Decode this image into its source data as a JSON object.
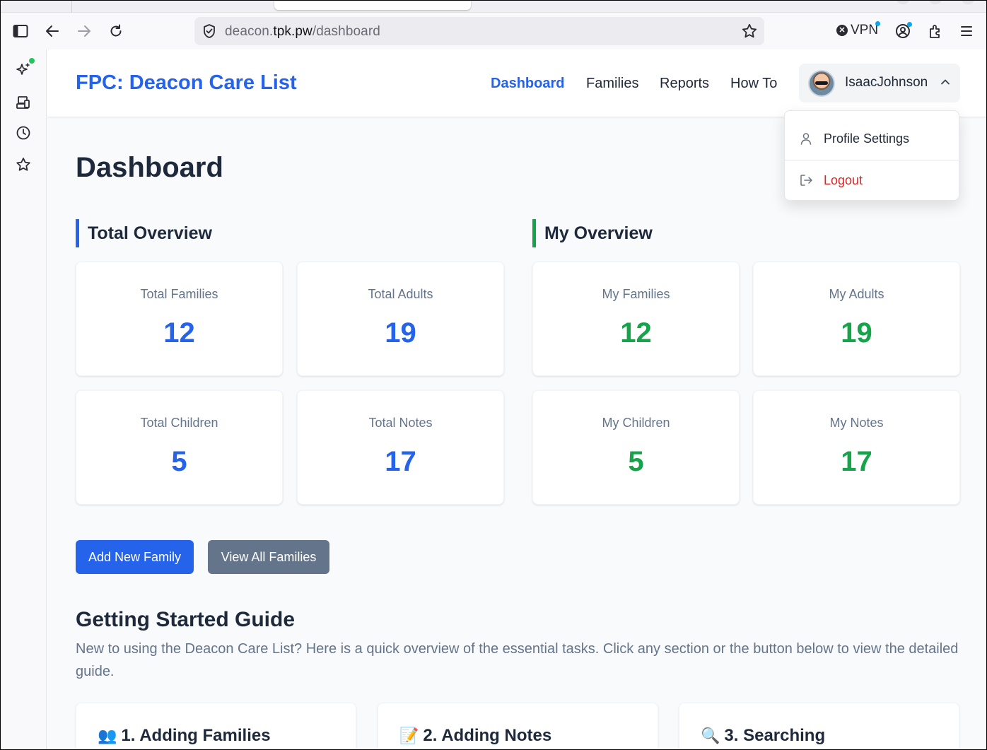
{
  "browser": {
    "url_prefix": "deacon.",
    "url_domain": "tpk.pw",
    "url_path": "/dashboard",
    "vpn_label": "VPN"
  },
  "header": {
    "brand": "FPC: Deacon Care List",
    "nav": [
      "Dashboard",
      "Families",
      "Reports",
      "How To"
    ],
    "active_nav": "Dashboard",
    "username": "IsaacJohnson"
  },
  "user_dropdown": {
    "profile_label": "Profile Settings",
    "logout_label": "Logout"
  },
  "page": {
    "title": "Dashboard"
  },
  "total_overview": {
    "title": "Total Overview",
    "stats": [
      {
        "label": "Total Families",
        "value": "12"
      },
      {
        "label": "Total Adults",
        "value": "19"
      },
      {
        "label": "Total Children",
        "value": "5"
      },
      {
        "label": "Total Notes",
        "value": "17"
      }
    ]
  },
  "my_overview": {
    "title": "My Overview",
    "stats": [
      {
        "label": "My Families",
        "value": "12"
      },
      {
        "label": "My Adults",
        "value": "19"
      },
      {
        "label": "My Children",
        "value": "5"
      },
      {
        "label": "My Notes",
        "value": "17"
      }
    ]
  },
  "actions": {
    "add_family": "Add New Family",
    "view_families": "View All Families"
  },
  "guide": {
    "title": "Getting Started Guide",
    "intro": "New to using the Deacon Care List? Here is a quick overview of the essential tasks. Click any section or the button below to view the detailed guide.",
    "cards": [
      {
        "emoji": "👥",
        "title": "1. Adding Families"
      },
      {
        "emoji": "📝",
        "title": "2. Adding Notes"
      },
      {
        "emoji": "🔍",
        "title": "3. Searching"
      }
    ]
  },
  "colors": {
    "primary": "#2563eb",
    "green": "#16a34a",
    "logout": "#dc2626",
    "secondary_button": "#64748b"
  }
}
